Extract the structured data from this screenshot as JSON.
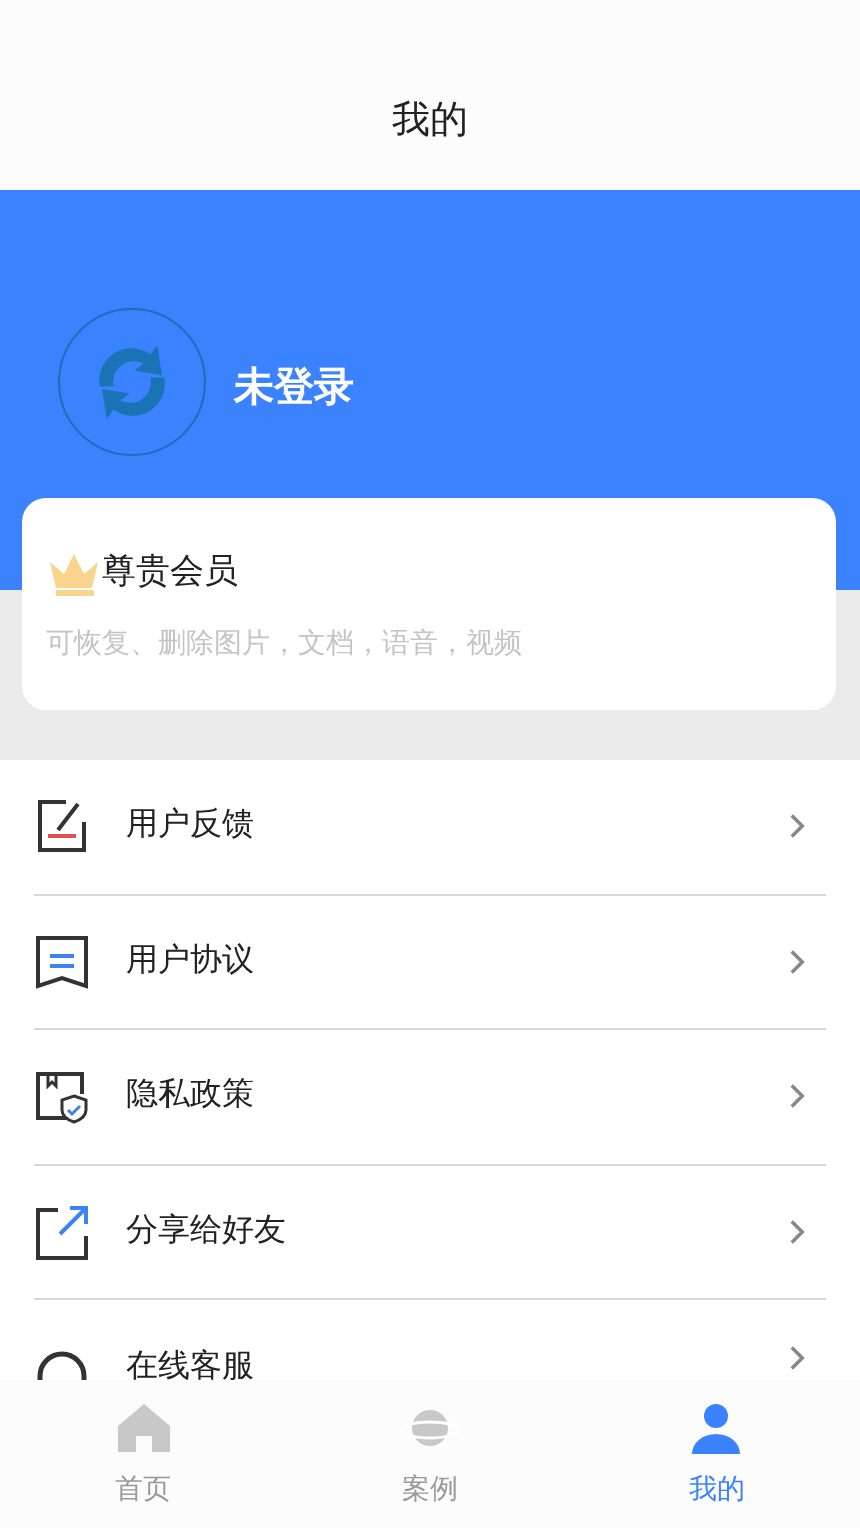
{
  "header": {
    "title": "我的"
  },
  "profile": {
    "name": "未登录"
  },
  "vip_card": {
    "title": "尊贵会员",
    "description": "可恢复、删除图片，文档，语音，视频"
  },
  "menu": [
    {
      "kind": "feedback",
      "label": "用户反馈"
    },
    {
      "kind": "agreement",
      "label": "用户协议"
    },
    {
      "kind": "privacy",
      "label": "隐私政策"
    },
    {
      "kind": "share",
      "label": "分享给好友"
    },
    {
      "kind": "service",
      "label": "在线客服"
    }
  ],
  "tabs": [
    {
      "kind": "home",
      "label": "首页",
      "selected": false
    },
    {
      "kind": "cases",
      "label": "案例",
      "selected": false
    },
    {
      "kind": "mine",
      "label": "我的",
      "selected": true
    }
  ]
}
